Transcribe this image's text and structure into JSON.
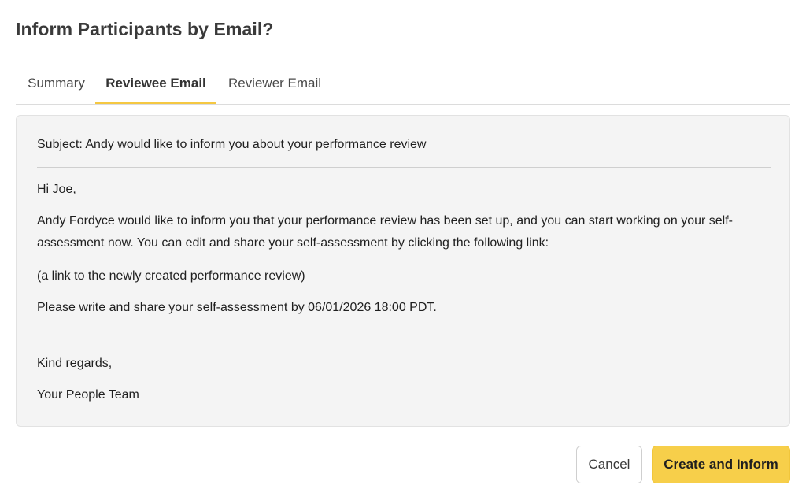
{
  "dialog": {
    "title": "Inform Participants by Email?"
  },
  "tabs": [
    {
      "label": "Summary",
      "active": false
    },
    {
      "label": "Reviewee Email",
      "active": true
    },
    {
      "label": "Reviewer Email",
      "active": false
    }
  ],
  "email": {
    "subject": "Subject: Andy would like to inform you about your performance review",
    "greeting": "Hi Joe,",
    "paragraph": "Andy Fordyce would like to inform you that your performance review has been set up, and you can start working on your self-assessment now. You can edit and share your self-assessment by clicking the following link:",
    "link_text": "(a link to the newly created performance review)",
    "deadline": "Please write and share your self-assessment by 06/01/2026 18:00 PDT.",
    "closing": "Kind regards,",
    "signature": "Your People Team"
  },
  "actions": {
    "cancel_label": "Cancel",
    "primary_label": "Create and Inform"
  },
  "colors": {
    "accent": "#f7cf4a",
    "tab_underline": "#f5c842",
    "email_background": "#f4f4f4"
  }
}
